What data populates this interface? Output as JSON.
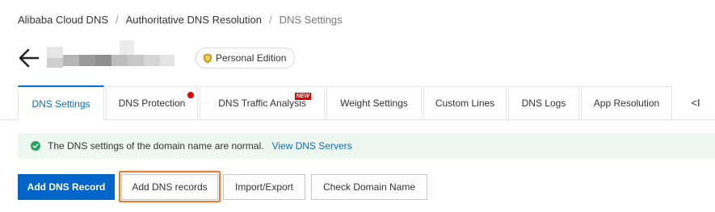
{
  "breadcrumb": {
    "items": [
      "Alibaba Cloud DNS",
      "Authoritative DNS Resolution",
      "DNS Settings"
    ],
    "separator": "/"
  },
  "header": {
    "back_icon": "arrow-left-icon",
    "edition_badge": "Personal Edition",
    "edition_icon": "shield-icon"
  },
  "tabs": [
    {
      "label": "DNS Settings",
      "active": true
    },
    {
      "label": "DNS Protection",
      "badge_dot": true
    },
    {
      "label": "DNS Traffic Analysis",
      "tag": "NEW"
    },
    {
      "label": "Weight Settings"
    },
    {
      "label": "Custom Lines"
    },
    {
      "label": "DNS Logs"
    },
    {
      "label": "App Resolution"
    }
  ],
  "tab_scroll_label": "<I",
  "alert": {
    "message": "The DNS settings of the domain name are normal.",
    "link": "View DNS Servers",
    "icon": "check-circle-icon"
  },
  "actions": {
    "add_record": "Add DNS Record",
    "add_records": "Add DNS records",
    "import_export": "Import/Export",
    "check_domain": "Check Domain Name"
  },
  "colors": {
    "primary": "#0064c8",
    "link": "#0070cc",
    "success": "#23a55a",
    "alert_bg": "#eef7f0",
    "highlight": "#ef7d30",
    "new_tag": "#e00000"
  }
}
